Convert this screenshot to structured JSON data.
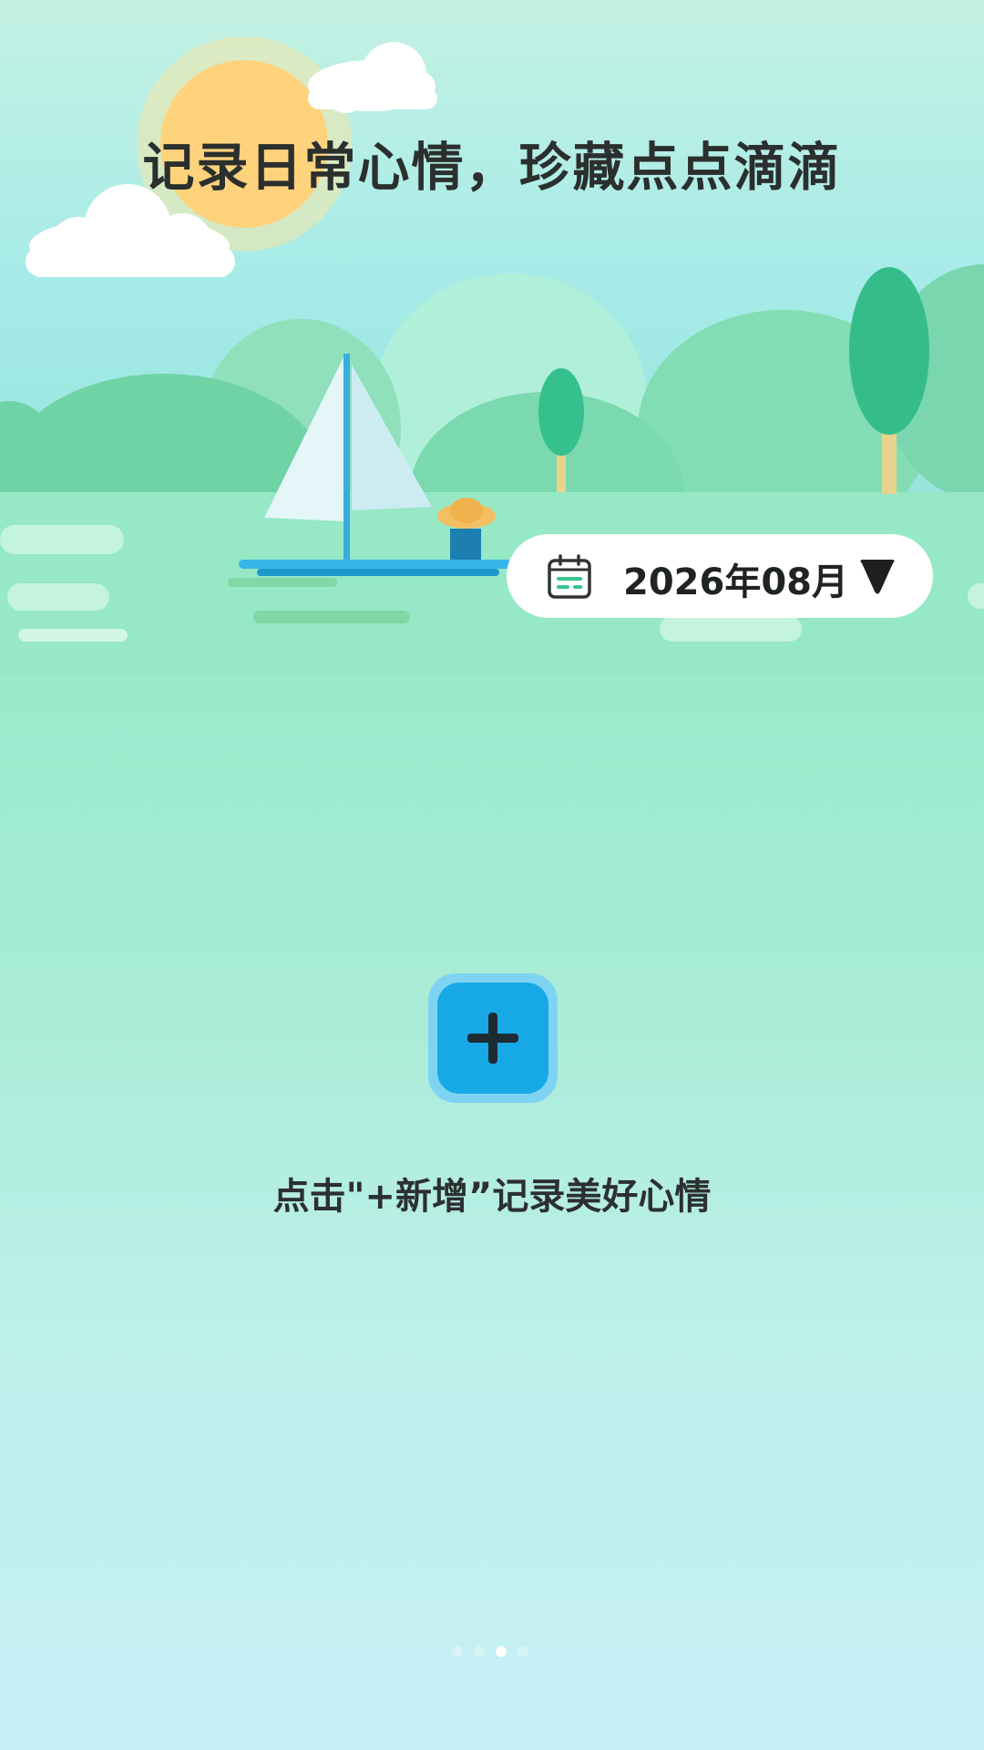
{
  "banner": {
    "headline": "记录日常心情，珍藏点点滴滴"
  },
  "date_selector": {
    "icon": "calendar-icon",
    "value": "2026年08月",
    "dropdown_icon": "triangle-down-icon"
  },
  "add_button": {
    "icon": "plus-icon"
  },
  "empty_hint": "点击\"+新增”记录美好心情",
  "pager": {
    "count": 4,
    "active_index": 2
  },
  "colors": {
    "accent_blue": "#16a9e6",
    "text_dark": "#2b2f2e",
    "hill_green": "#6fd8a8",
    "sun": "#ffd27a"
  }
}
